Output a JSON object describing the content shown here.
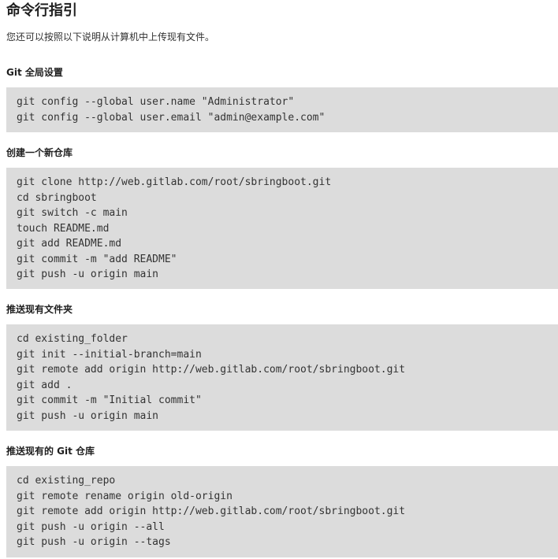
{
  "page": {
    "title": "命令行指引",
    "intro": "您还可以按照以下说明从计算机中上传现有文件。"
  },
  "sections": [
    {
      "heading": "Git 全局设置",
      "lines": [
        "git config --global user.name \"Administrator\"",
        "git config --global user.email \"admin@example.com\""
      ]
    },
    {
      "heading": "创建一个新仓库",
      "lines": [
        "git clone http://web.gitlab.com/root/sbringboot.git",
        "cd sbringboot",
        "git switch -c main",
        "touch README.md",
        "git add README.md",
        "git commit -m \"add README\"",
        "git push -u origin main"
      ]
    },
    {
      "heading": "推送现有文件夹",
      "lines": [
        "cd existing_folder",
        "git init --initial-branch=main",
        "git remote add origin http://web.gitlab.com/root/sbringboot.git",
        "git add .",
        "git commit -m \"Initial commit\"",
        "git push -u origin main"
      ]
    },
    {
      "heading": "推送现有的 Git 仓库",
      "lines": [
        "cd existing_repo",
        "git remote rename origin old-origin",
        "git remote add origin http://web.gitlab.com/root/sbringboot.git",
        "git push -u origin --all",
        "git push -u origin --tags"
      ]
    }
  ]
}
